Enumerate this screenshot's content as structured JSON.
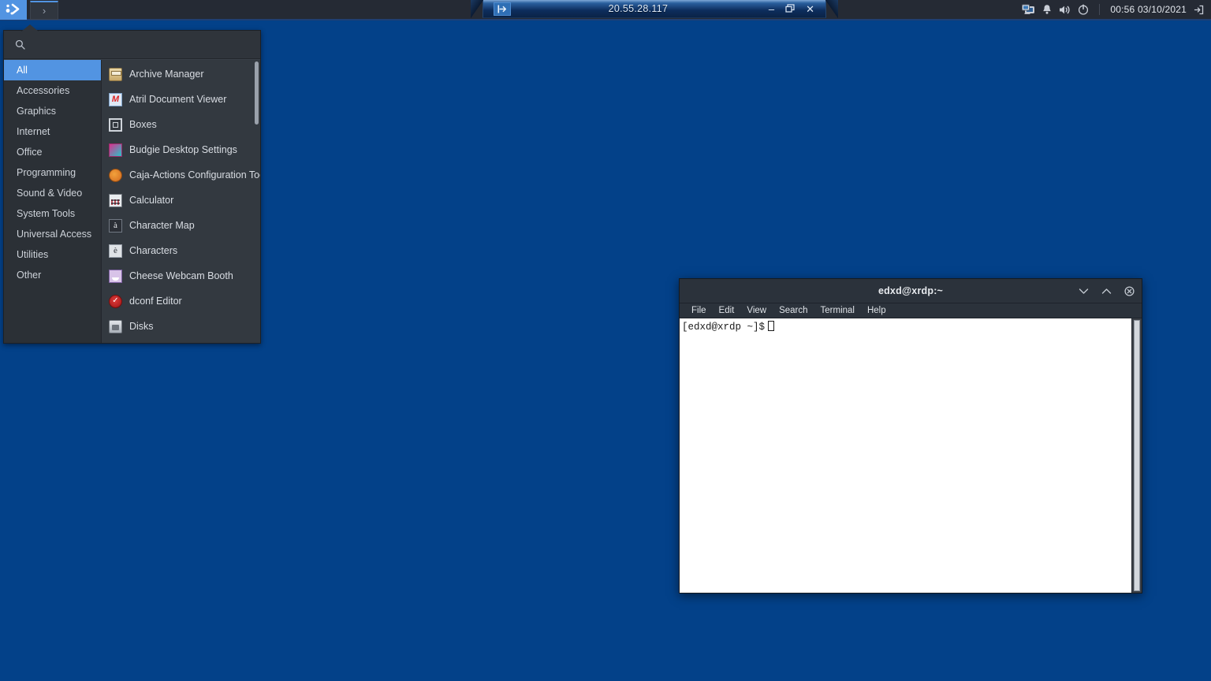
{
  "desktop": {
    "background_color": "#034189"
  },
  "rdp_bar": {
    "host": "20.55.28.117",
    "pin_icon": "pin-icon",
    "minimize_label": "–",
    "restore_label": "❐",
    "close_label": "✕"
  },
  "panel": {
    "menu_button_icon": "budgie-menu-icon",
    "tasks": [
      {
        "name": "terminal",
        "icon": "terminal-prompt-icon",
        "label": "›",
        "active": true
      }
    ],
    "tray": [
      {
        "name": "display-icon",
        "glyph": "display"
      },
      {
        "name": "notification-bell-icon",
        "glyph": "bell"
      },
      {
        "name": "volume-icon",
        "glyph": "speaker"
      },
      {
        "name": "power-icon",
        "glyph": "power"
      }
    ],
    "clock": "00:56 03/10/2021",
    "logout_icon": "logout-icon"
  },
  "app_menu": {
    "search": {
      "placeholder": "",
      "value": "",
      "icon": "search-icon"
    },
    "categories": [
      {
        "label": "All",
        "active": true
      },
      {
        "label": "Accessories",
        "active": false
      },
      {
        "label": "Graphics",
        "active": false
      },
      {
        "label": "Internet",
        "active": false
      },
      {
        "label": "Office",
        "active": false
      },
      {
        "label": "Programming",
        "active": false
      },
      {
        "label": "Sound & Video",
        "active": false
      },
      {
        "label": "System Tools",
        "active": false
      },
      {
        "label": "Universal Access",
        "active": false
      },
      {
        "label": "Utilities",
        "active": false
      },
      {
        "label": "Other",
        "active": false
      }
    ],
    "apps": [
      {
        "label": "Archive Manager",
        "icon": "archive-manager-icon",
        "icon_class": "ico-archive",
        "glyph": ""
      },
      {
        "label": "Atril Document Viewer",
        "icon": "atril-document-viewer-icon",
        "icon_class": "ico-atril",
        "glyph": ""
      },
      {
        "label": "Boxes",
        "icon": "boxes-icon",
        "icon_class": "ico-boxes",
        "glyph": ""
      },
      {
        "label": "Budgie Desktop Settings",
        "icon": "budgie-desktop-settings-icon",
        "icon_class": "ico-budgie",
        "glyph": ""
      },
      {
        "label": "Caja-Actions Configuration Tool",
        "icon": "caja-actions-icon",
        "icon_class": "ico-caja",
        "glyph": ""
      },
      {
        "label": "Calculator",
        "icon": "calculator-icon",
        "icon_class": "ico-calc",
        "glyph": ""
      },
      {
        "label": "Character Map",
        "icon": "character-map-icon",
        "icon_class": "ico-charmap",
        "glyph": "à"
      },
      {
        "label": "Characters",
        "icon": "characters-icon",
        "icon_class": "ico-characters",
        "glyph": "è"
      },
      {
        "label": "Cheese Webcam Booth",
        "icon": "cheese-webcam-booth-icon",
        "icon_class": "ico-cheese",
        "glyph": ""
      },
      {
        "label": "dconf Editor",
        "icon": "dconf-editor-icon",
        "icon_class": "ico-dconf",
        "glyph": "✓"
      },
      {
        "label": "Disks",
        "icon": "disks-icon",
        "icon_class": "ico-disks",
        "glyph": ""
      }
    ]
  },
  "terminal": {
    "title": "edxd@xrdp:~",
    "window_buttons": {
      "minimize": "⌄",
      "maximize": "⌃",
      "close": "⊗"
    },
    "menus": [
      "File",
      "Edit",
      "View",
      "Search",
      "Terminal",
      "Help"
    ],
    "prompt": "[edxd@xrdp ~]$",
    "background_color": "#ffffff",
    "foreground_color": "#1b1b1b"
  }
}
